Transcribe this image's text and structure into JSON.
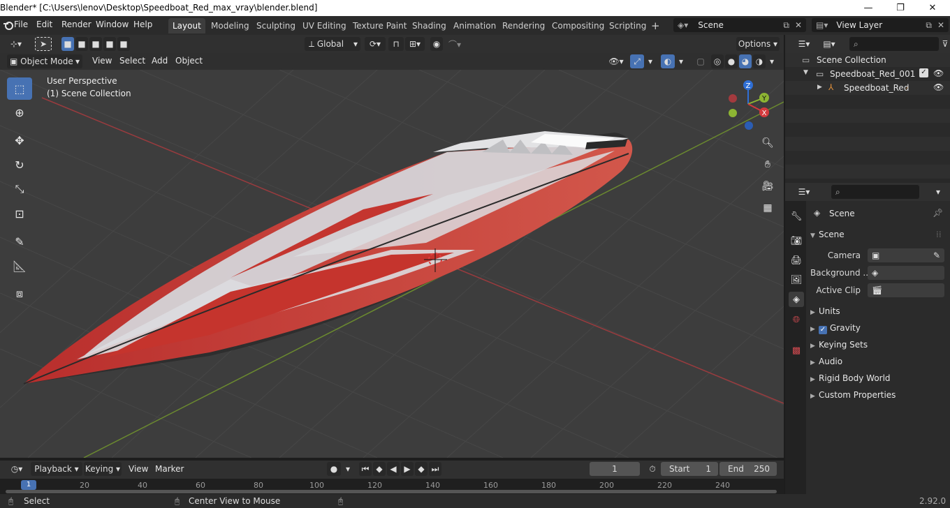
{
  "window": {
    "title": "Blender* [C:\\Users\\lenov\\Desktop\\Speedboat_Red_max_vray\\blender.blend]",
    "minimize": "—",
    "maximize": "❐",
    "close": "✕"
  },
  "menu": [
    "File",
    "Edit",
    "Render",
    "Window",
    "Help"
  ],
  "workspaces": [
    "Layout",
    "Modeling",
    "Sculpting",
    "UV Editing",
    "Texture Paint",
    "Shading",
    "Animation",
    "Rendering",
    "Compositing",
    "Scripting"
  ],
  "active_workspace": "Layout",
  "scene_selector": {
    "value": "Scene"
  },
  "view_layer_selector": {
    "value": "View Layer"
  },
  "tool_header": {
    "orientation": "Global",
    "options": "Options"
  },
  "viewport_header": {
    "mode": "Object Mode",
    "menus": [
      "View",
      "Select",
      "Add",
      "Object"
    ]
  },
  "viewport": {
    "perspective": "User Perspective",
    "collection": "(1) Scene Collection",
    "gizmo": {
      "x": "X",
      "y": "Y",
      "z": "Z"
    }
  },
  "outliner": {
    "root": "Scene Collection",
    "items": [
      {
        "label": "Speedboat_Red_001"
      },
      {
        "label": "Speedboat_Red"
      }
    ]
  },
  "properties": {
    "context": "Scene",
    "panel_title": "Scene",
    "fields": [
      {
        "label": "Camera",
        "value": ""
      },
      {
        "label": "Background ...",
        "value": ""
      },
      {
        "label": "Active Clip",
        "value": ""
      }
    ],
    "sections": [
      "Units",
      "Gravity",
      "Keying Sets",
      "Audio",
      "Rigid Body World",
      "Custom Properties"
    ],
    "gravity_checked": true
  },
  "timeline": {
    "menus": [
      "Playback",
      "Keying",
      "View",
      "Marker"
    ],
    "current_frame": "1",
    "start_label": "Start",
    "start": "1",
    "end_label": "End",
    "end": "250",
    "ticks": [
      "1",
      "20",
      "40",
      "60",
      "80",
      "100",
      "120",
      "140",
      "160",
      "180",
      "200",
      "220",
      "240"
    ]
  },
  "statusbar": {
    "left": "Select",
    "middle": "Center View to Mouse",
    "version": "2.92.0"
  },
  "colors": {
    "accent": "#4772b3",
    "boat_red": "#c8392f",
    "boat_white": "#d9d9dc",
    "axis_x": "#d4393d",
    "axis_y": "#8db533",
    "axis_z": "#2f6fd6"
  }
}
